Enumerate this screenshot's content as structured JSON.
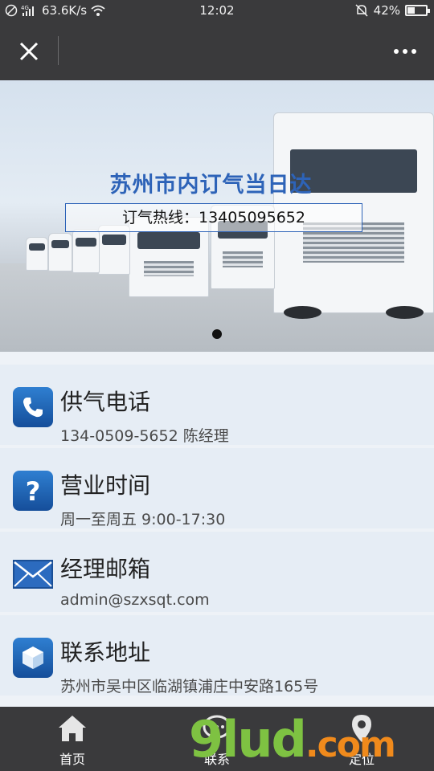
{
  "status_bar": {
    "network_speed": "63.6K/s",
    "time": "12:02",
    "battery": "42%",
    "battery_level": 0.42,
    "icons": [
      "do-not-disturb-icon",
      "signal-4g-icon",
      "wifi-icon",
      "mute-bell-icon",
      "battery-icon"
    ]
  },
  "title_bar": {
    "close_icon": "close-icon",
    "more_icon": "more-dots-icon"
  },
  "banner": {
    "title": "苏州市内订气当日达",
    "hotline": "订气热线：13405095652",
    "active_slide": 1,
    "slide_count": 1
  },
  "info_items": [
    {
      "label": "供气电话",
      "value": "134-0509-5652 陈经理",
      "icon": "phone-icon"
    },
    {
      "label": "营业时间",
      "value": "周一至周五 9:00-17:30",
      "icon": "question-icon"
    },
    {
      "label": "经理邮箱",
      "value": "admin@szxsqt.com",
      "icon": "mail-icon"
    },
    {
      "label": "联系地址",
      "value": "苏州市吴中区临湖镇浦庄中安路165号",
      "icon": "location-cube-icon"
    }
  ],
  "bottom_nav": [
    {
      "label": "首页",
      "icon": "home-icon"
    },
    {
      "label": "联系",
      "icon": "chat-icon"
    },
    {
      "label": "定位",
      "icon": "map-pin-icon"
    }
  ],
  "watermark": {
    "text_main": "9lud",
    "text_suffix": ".com"
  },
  "colors": {
    "bar_bg": "#3a3a3c",
    "banner_title": "#2d63b8",
    "item_bg": "#e6edf5",
    "page_bg": "#eef2f7"
  }
}
